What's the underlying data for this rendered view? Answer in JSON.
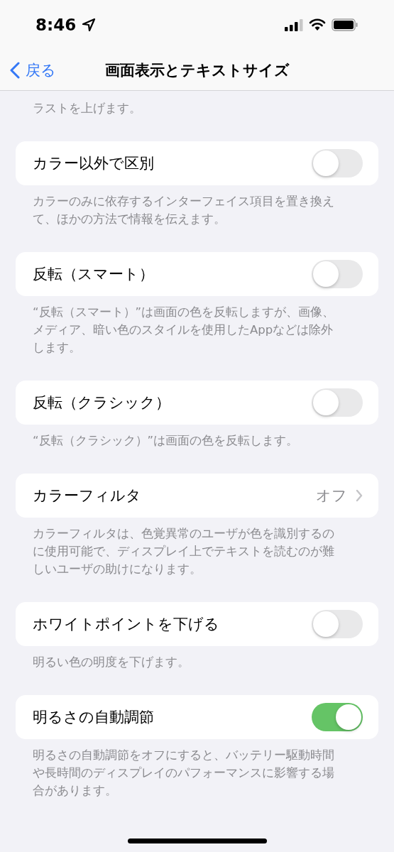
{
  "status_bar": {
    "time": "8:46"
  },
  "nav": {
    "back": "戻る",
    "title": "画面表示とテキストサイズ"
  },
  "top_footer": "ラストを上げます。",
  "rows": [
    {
      "kind": "toggle",
      "label": "カラー以外で区別",
      "on": false,
      "footer": "カラーのみに依存するインターフェイス項目を置き換えて、ほかの方法で情報を伝えます。"
    },
    {
      "kind": "toggle",
      "label": "反転（スマート）",
      "on": false,
      "footer": "“反転（スマート）”は画面の色を反転しますが、画像、メディア、暗い色のスタイルを使用したAppなどは除外します。"
    },
    {
      "kind": "toggle",
      "label": "反転（クラシック）",
      "on": false,
      "footer": "“反転（クラシック）”は画面の色を反転します。"
    },
    {
      "kind": "disclosure",
      "label": "カラーフィルタ",
      "value": "オフ",
      "footer": "カラーフィルタは、色覚異常のユーザが色を識別するのに使用可能で、ディスプレイ上でテキストを読むのが難しいユーザの助けになります。"
    },
    {
      "kind": "toggle",
      "label": "ホワイトポイントを下げる",
      "on": false,
      "footer": "明るい色の明度を下げます。"
    },
    {
      "kind": "toggle",
      "label": "明るさの自動調節",
      "on": true,
      "footer": "明るさの自動調節をオフにすると、バッテリー駆動時間や長時間のディスプレイのパフォーマンスに影響する場合があります。"
    }
  ]
}
